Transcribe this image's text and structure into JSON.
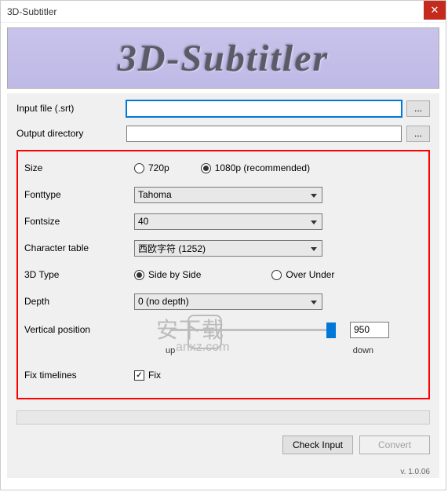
{
  "window": {
    "title": "3D-Subtitler"
  },
  "banner": {
    "text": "3D-Subtitler"
  },
  "labels": {
    "input_file": "Input file (.srt)",
    "output_dir": "Output directory",
    "size": "Size",
    "fonttype": "Fonttype",
    "fontsize": "Fontsize",
    "char_table": "Character table",
    "type3d": "3D Type",
    "depth": "Depth",
    "vpos": "Vertical position",
    "fix_timelines": "Fix timelines"
  },
  "values": {
    "input_file": "",
    "output_dir": "",
    "size_720p": "720p",
    "size_1080p": "1080p (recommended)",
    "fonttype": "Tahoma",
    "fontsize": "40",
    "char_table": "西欧字符 (1252)",
    "type3d_sbs": "Side by Side",
    "type3d_ou": "Over Under",
    "depth": "0 (no depth)",
    "vpos_value": "950",
    "vpos_up": "up",
    "vpos_down": "down",
    "fix_label": "Fix"
  },
  "buttons": {
    "browse": "...",
    "check_input": "Check Input",
    "convert": "Convert"
  },
  "selected": {
    "size": "1080p",
    "type3d": "sbs",
    "fix": true
  },
  "version": "v. 1.0.06",
  "watermark": {
    "text": "安下载",
    "sub": "anxz.com"
  }
}
